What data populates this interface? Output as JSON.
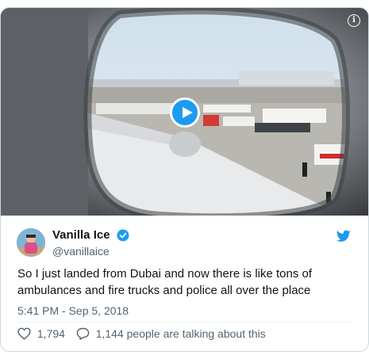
{
  "tweet": {
    "display_name": "Vanilla Ice",
    "handle": "@vanillaice",
    "text": "So I just landed from Dubai and now there is like tons of ambulances and fire trucks and police all over the place",
    "timestamp": "5:41 PM - Sep 5, 2018",
    "like_count": "1,794",
    "conversation_text": "1,144 people are talking about this"
  },
  "media": {
    "info_glyph": "i",
    "play_icon": "play-icon",
    "content": "video of airport tarmac through airplane window"
  },
  "colors": {
    "accent": "#1d9bf0",
    "text": "#0f1419",
    "secondary": "#536471",
    "border": "#cfd9de"
  },
  "icons": [
    "info-icon",
    "play-icon",
    "verified-badge-icon",
    "twitter-bird-icon",
    "heart-icon",
    "reply-bubble-icon"
  ]
}
